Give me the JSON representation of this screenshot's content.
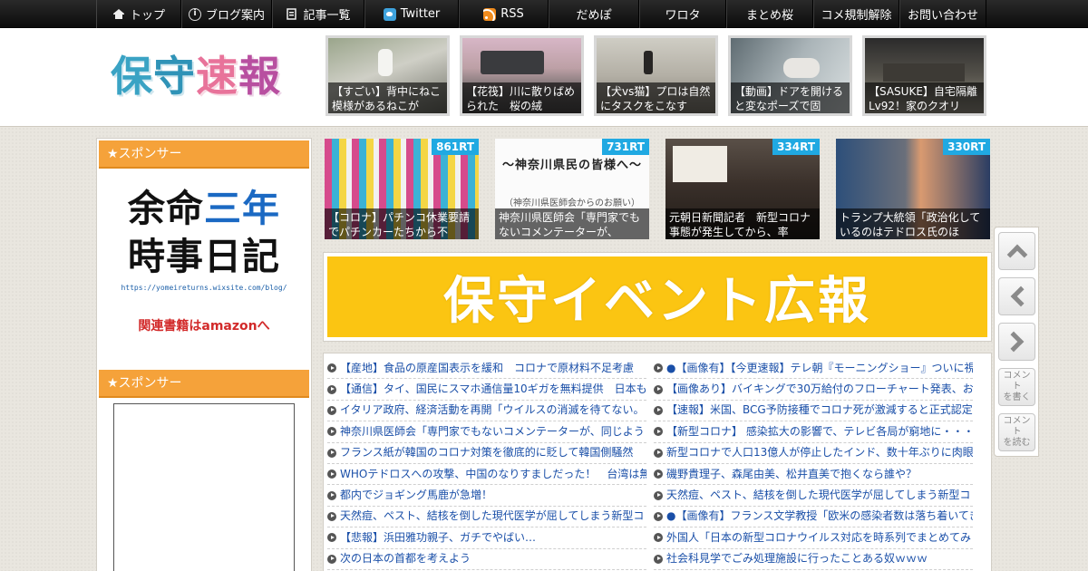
{
  "nav": {
    "items": [
      {
        "label": "トップ",
        "icon": "home-icon"
      },
      {
        "label": "ブログ案内",
        "icon": "info-icon"
      },
      {
        "label": "記事一覧",
        "icon": "list-icon"
      },
      {
        "label": "Twitter",
        "icon": "twitter-icon"
      },
      {
        "label": "RSS",
        "icon": "rss-icon"
      },
      {
        "label": "だめぽ",
        "icon": ""
      },
      {
        "label": "ワロタ",
        "icon": ""
      },
      {
        "label": "まとめ桜",
        "icon": ""
      },
      {
        "label": "コメ規制解除",
        "icon": ""
      },
      {
        "label": "お問い合わせ",
        "icon": ""
      }
    ]
  },
  "header": {
    "logo": [
      "保",
      "守",
      "速",
      "報"
    ],
    "featured": [
      {
        "caption": "【すごい】背中にねこ模様があるねこが"
      },
      {
        "caption": "【花筏】川に散りばめられた　桜の絨"
      },
      {
        "caption": "【犬vs猫】プロは自然にタスクをこなす"
      },
      {
        "caption": "【動画】ドアを開けると変なポーズで固"
      },
      {
        "caption": "【SASUKE】自宅隔離Lv92！家のクオリ"
      }
    ]
  },
  "sidebar": {
    "widget1_title": "★スポンサー",
    "widget2_title": "★スポンサー",
    "ad1": {
      "line1a": "余命",
      "line1b": "三年",
      "line2": "時事日記",
      "url": "https://yomeireturns.wixsite.com/blog/",
      "amazon": "関連書籍はamazonへ"
    }
  },
  "ranking": [
    {
      "rt": "861RT",
      "caption": "【コロナ】パチンコ休業要請でパチンカーたちから不"
    },
    {
      "rt": "731RT",
      "caption": "神奈川県医師会「専門家でもないコメンテーターが、",
      "img_title": "～神奈川県民の皆様へ～",
      "img_sub": "（神奈川県医師会からのお願い）"
    },
    {
      "rt": "334RT",
      "caption": "元朝日新聞記者　新型コロナ事態が発生してから、率"
    },
    {
      "rt": "330RT",
      "caption": "トランプ大統領「政治化しているのはテドロス氏のほ"
    }
  ],
  "banner": {
    "text": "保守イベント広報"
  },
  "articles": {
    "left": [
      "【産地】食品の原産国表示を緩和　コロナで原材料不足考慮",
      "【通信】タイ、国民にスマホ通信量10ギガを無料提供　日本も",
      "イタリア政府、経済活動を再開「ウイルスの消滅を待てない。",
      "神奈川県医師会「専門家でもないコメンテーターが、同じよう",
      "フランス紙が韓国のコロナ対策を徹底的に貶して韓国側騒然",
      "WHOテドロスへの攻撃、中国のなりすましだった！　台湾は無",
      "都内でジョギング馬鹿が急増！",
      "天然痘、ペスト、結核を倒した現代医学が屈してしまう新型コ",
      "【悲報】浜田雅功親子、ガチでやばい…",
      "次の日本の首都を考えよう"
    ],
    "right": [
      "●【画像有】【今更速報】テレ朝『モーニングショー』ついに視",
      "【画像あり】バイキングで30万給付のフローチャート発表、お",
      "【速報】米国、BCG予防接種でコロナ死が激減すると正式認定",
      "【新型コロナ】 感染拡大の影響で、テレビ各局が窮地に・・・",
      "新型コロナで人口13億人が停止したインド、数十年ぶりに肉眼",
      "磯野貴理子、森尾由美、松井直美で抱くなら誰や？",
      "天然痘、ペスト、結核を倒した現代医学が屈してしまう新型コ",
      "●【画像有】フランス文学教授「欧米の感染者数は落ち着いてき",
      "外国人「日本の新型コロナウイルス対応を時系列でまとめてみ",
      "社会科見学でごみ処理施設に行ったことある奴ｗｗｗ"
    ]
  },
  "tools": {
    "write_comment": "コメントを書く",
    "read_comment": "コメントを読む"
  }
}
